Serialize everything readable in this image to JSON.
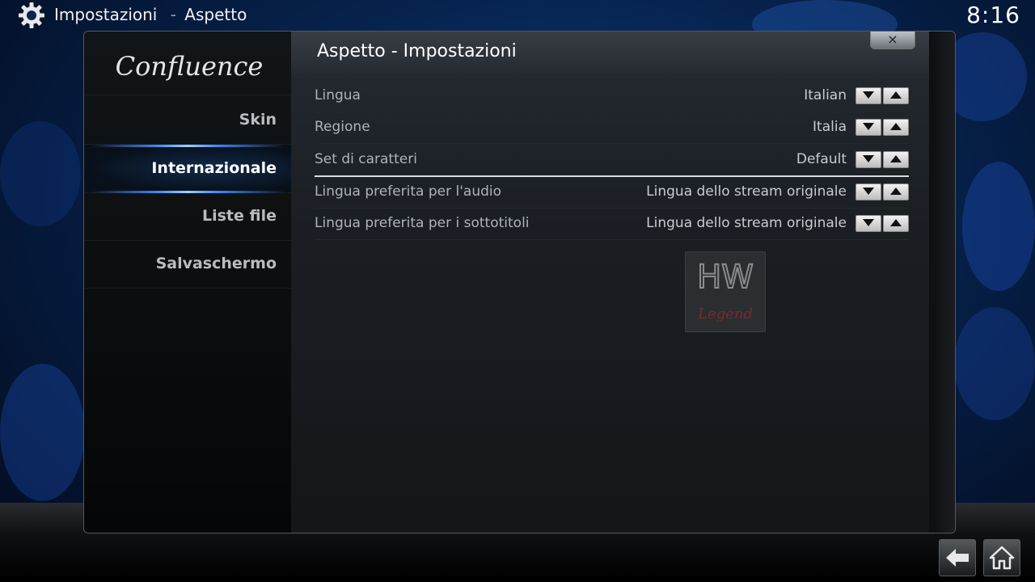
{
  "header": {
    "section": "Impostazioni",
    "separator": "-",
    "subsection": "Aspetto",
    "clock": "8:16",
    "icon": "gear-icon"
  },
  "sidebar": {
    "logo_text": "Confluence",
    "items": [
      {
        "label": "Skin",
        "active": false
      },
      {
        "label": "Internazionale",
        "active": true
      },
      {
        "label": "Liste file",
        "active": false
      },
      {
        "label": "Salvaschermo",
        "active": false
      }
    ]
  },
  "dialog": {
    "title": "Aspetto - Impostazioni",
    "close_label": "×",
    "settings": [
      {
        "label": "Lingua",
        "value": "Italian"
      },
      {
        "label": "Regione",
        "value": "Italia"
      },
      {
        "label": "Set di caratteri",
        "value": "Default"
      },
      {
        "label": "Lingua preferita per l'audio",
        "value": "Lingua dello stream originale"
      },
      {
        "label": "Lingua preferita per i sottotitoli",
        "value": "Lingua dello stream originale"
      }
    ],
    "selected_index": 2
  },
  "watermark": {
    "line1": "HW",
    "line2": "Legend"
  },
  "nav": {
    "back_icon": "back-arrow-icon",
    "home_icon": "home-icon"
  },
  "colors": {
    "accent": "#3b8cff",
    "background": "#06214a"
  }
}
